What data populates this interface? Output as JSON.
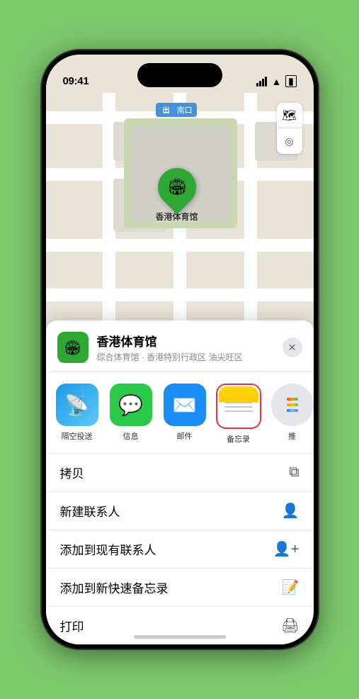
{
  "status_bar": {
    "time": "09:41",
    "signal": "signal",
    "wifi": "wifi",
    "battery": "battery"
  },
  "map": {
    "label": "南口",
    "controls": {
      "map_icon": "🗺",
      "location_icon": "⬆"
    },
    "marker": {
      "name": "香港体育馆",
      "icon": "🏟"
    }
  },
  "sheet": {
    "title": "香港体育馆",
    "subtitle": "综合体育馆 · 香港特别行政区 油尖旺区",
    "close": "✕",
    "logo_icon": "🏟"
  },
  "share_actions": [
    {
      "id": "airdrop",
      "label": "隔空投送",
      "type": "airdrop"
    },
    {
      "id": "message",
      "label": "信息",
      "type": "message"
    },
    {
      "id": "mail",
      "label": "邮件",
      "type": "mail"
    },
    {
      "id": "notes",
      "label": "备忘录",
      "type": "notes"
    },
    {
      "id": "more",
      "label": "推",
      "type": "more"
    }
  ],
  "action_items": [
    {
      "label": "拷贝",
      "icon": "copy"
    },
    {
      "label": "新建联系人",
      "icon": "person"
    },
    {
      "label": "添加到现有联系人",
      "icon": "person-add"
    },
    {
      "label": "添加到新快速备忘录",
      "icon": "note"
    },
    {
      "label": "打印",
      "icon": "print"
    }
  ]
}
